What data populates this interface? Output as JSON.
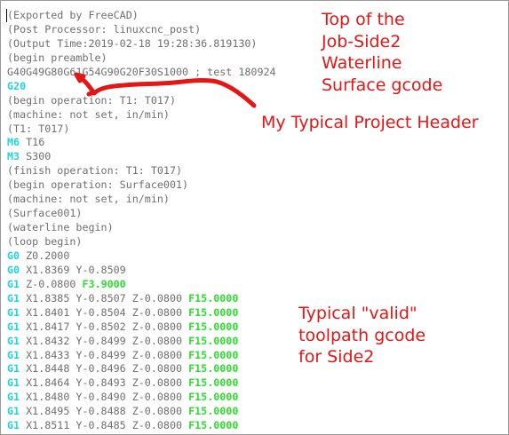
{
  "editor": {
    "lines": [
      {
        "text": "(Exported by FreeCAD)"
      },
      {
        "text": "(Post Processor: linuxcnc_post)"
      },
      {
        "text": "(Output Time:2019-02-18 19:28:36.819130)"
      },
      {
        "text": "(begin preamble)"
      },
      {
        "text": "G40G49G80G61G54G90G20F30S1000 ; test 180924"
      },
      {
        "code": "G20",
        "rest": ""
      },
      {
        "text": "(begin operation: T1: T017)"
      },
      {
        "text": "(machine: not set, in/min)"
      },
      {
        "text": "(T1: T017)"
      },
      {
        "code": "M6",
        "rest": " T16"
      },
      {
        "code": "M3",
        "rest": " S300"
      },
      {
        "text": "(finish operation: T1: T017)"
      },
      {
        "text": "(begin operation: Surface001)"
      },
      {
        "text": "(machine: not set, in/min)"
      },
      {
        "text": "(Surface001)"
      },
      {
        "text": "(waterline begin)"
      },
      {
        "text": "(loop begin)"
      },
      {
        "code": "G0",
        "rest": " Z0.2000"
      },
      {
        "code": "G0",
        "rest": " X1.8369 Y-0.8509"
      },
      {
        "code": "G1",
        "rest": " Z-0.0800 ",
        "feed": "F3.9000"
      },
      {
        "code": "G1",
        "rest": " X1.8385 Y-0.8507 Z-0.0800 ",
        "feed": "F15.0000"
      },
      {
        "code": "G1",
        "rest": " X1.8401 Y-0.8504 Z-0.0800 ",
        "feed": "F15.0000"
      },
      {
        "code": "G1",
        "rest": " X1.8417 Y-0.8502 Z-0.0800 ",
        "feed": "F15.0000"
      },
      {
        "code": "G1",
        "rest": " X1.8432 Y-0.8499 Z-0.0800 ",
        "feed": "F15.0000"
      },
      {
        "code": "G1",
        "rest": " X1.8433 Y-0.8499 Z-0.0800 ",
        "feed": "F15.0000"
      },
      {
        "code": "G1",
        "rest": " X1.8448 Y-0.8496 Z-0.0800 ",
        "feed": "F15.0000"
      },
      {
        "code": "G1",
        "rest": " X1.8464 Y-0.8493 Z-0.0800 ",
        "feed": "F15.0000"
      },
      {
        "code": "G1",
        "rest": " X1.8480 Y-0.8490 Z-0.0800 ",
        "feed": "F15.0000"
      },
      {
        "code": "G1",
        "rest": " X1.8495 Y-0.8488 Z-0.0800 ",
        "feed": "F15.0000"
      },
      {
        "code": "G1",
        "rest": " X1.8511 Y-0.8485 Z-0.0800 ",
        "feed": "F15.0000"
      }
    ]
  },
  "annotations": {
    "top": [
      "Top of the",
      "Job-Side2",
      "Waterline",
      "Surface gcode"
    ],
    "header": "My Typical Project Header",
    "valid": [
      "Typical \"valid\"",
      "toolpath gcode",
      "for Side2"
    ]
  },
  "colors": {
    "annotation": "#e41616",
    "gcode_keyword": "#21d3dd",
    "feedrate": "#2fdc2f",
    "comment_text": "#6f6f6f"
  }
}
